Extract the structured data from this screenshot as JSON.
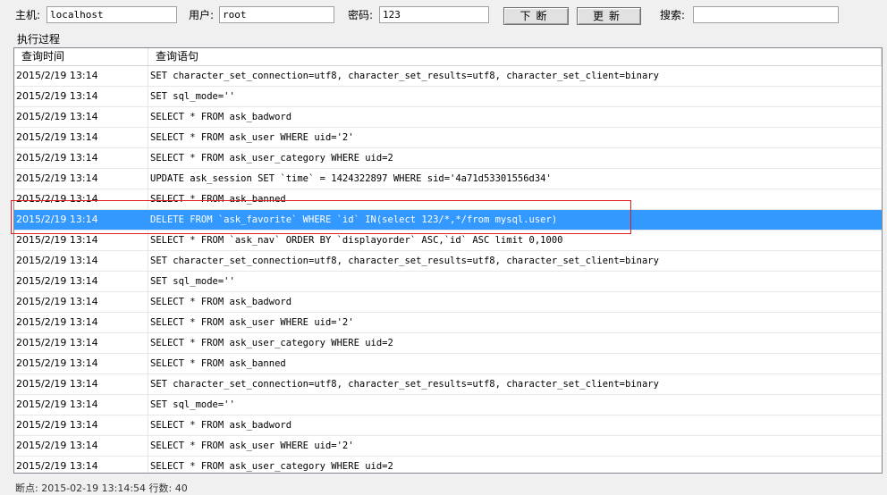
{
  "toolbar": {
    "host_label": "主机:",
    "host_value": "localhost",
    "user_label": "用户:",
    "user_value": "root",
    "password_label": "密码:",
    "password_value": "123",
    "break_button": "下断",
    "update_button": "更新",
    "search_label": "搜索:",
    "search_value": ""
  },
  "section_title": "执行过程",
  "table": {
    "columns": [
      "查询时间",
      "查询语句"
    ],
    "selected_index": 7,
    "rows": [
      [
        "2015/2/19 13:14",
        "SET character_set_connection=utf8, character_set_results=utf8, character_set_client=binary"
      ],
      [
        "2015/2/19 13:14",
        "SET sql_mode=''"
      ],
      [
        "2015/2/19 13:14",
        "SELECT * FROM ask_badword"
      ],
      [
        "2015/2/19 13:14",
        "SELECT * FROM ask_user WHERE uid='2'"
      ],
      [
        "2015/2/19 13:14",
        "SELECT * FROM ask_user_category WHERE uid=2"
      ],
      [
        "2015/2/19 13:14",
        "UPDATE ask_session SET `time` = 1424322897 WHERE sid='4a71d53301556d34'"
      ],
      [
        "2015/2/19 13:14",
        "SELECT * FROM ask_banned"
      ],
      [
        "2015/2/19 13:14",
        "DELETE FROM `ask_favorite` WHERE `id` IN(select 123/*,*/from mysql.user)"
      ],
      [
        "2015/2/19 13:14",
        "SELECT * FROM `ask_nav` ORDER BY `displayorder` ASC,`id` ASC limit 0,1000"
      ],
      [
        "2015/2/19 13:14",
        "SET character_set_connection=utf8, character_set_results=utf8, character_set_client=binary"
      ],
      [
        "2015/2/19 13:14",
        "SET sql_mode=''"
      ],
      [
        "2015/2/19 13:14",
        "SELECT * FROM ask_badword"
      ],
      [
        "2015/2/19 13:14",
        "SELECT * FROM ask_user WHERE uid='2'"
      ],
      [
        "2015/2/19 13:14",
        "SELECT * FROM ask_user_category WHERE uid=2"
      ],
      [
        "2015/2/19 13:14",
        "SELECT * FROM ask_banned"
      ],
      [
        "2015/2/19 13:14",
        "SET character_set_connection=utf8, character_set_results=utf8, character_set_client=binary"
      ],
      [
        "2015/2/19 13:14",
        "SET sql_mode=''"
      ],
      [
        "2015/2/19 13:14",
        "SELECT * FROM ask_badword"
      ],
      [
        "2015/2/19 13:14",
        "SELECT * FROM ask_user WHERE uid='2'"
      ],
      [
        "2015/2/19 13:14",
        "SELECT * FROM ask_user_category WHERE uid=2"
      ]
    ]
  },
  "status_bar": "断点: 2015-02-19 13:14:54    行数: 40"
}
